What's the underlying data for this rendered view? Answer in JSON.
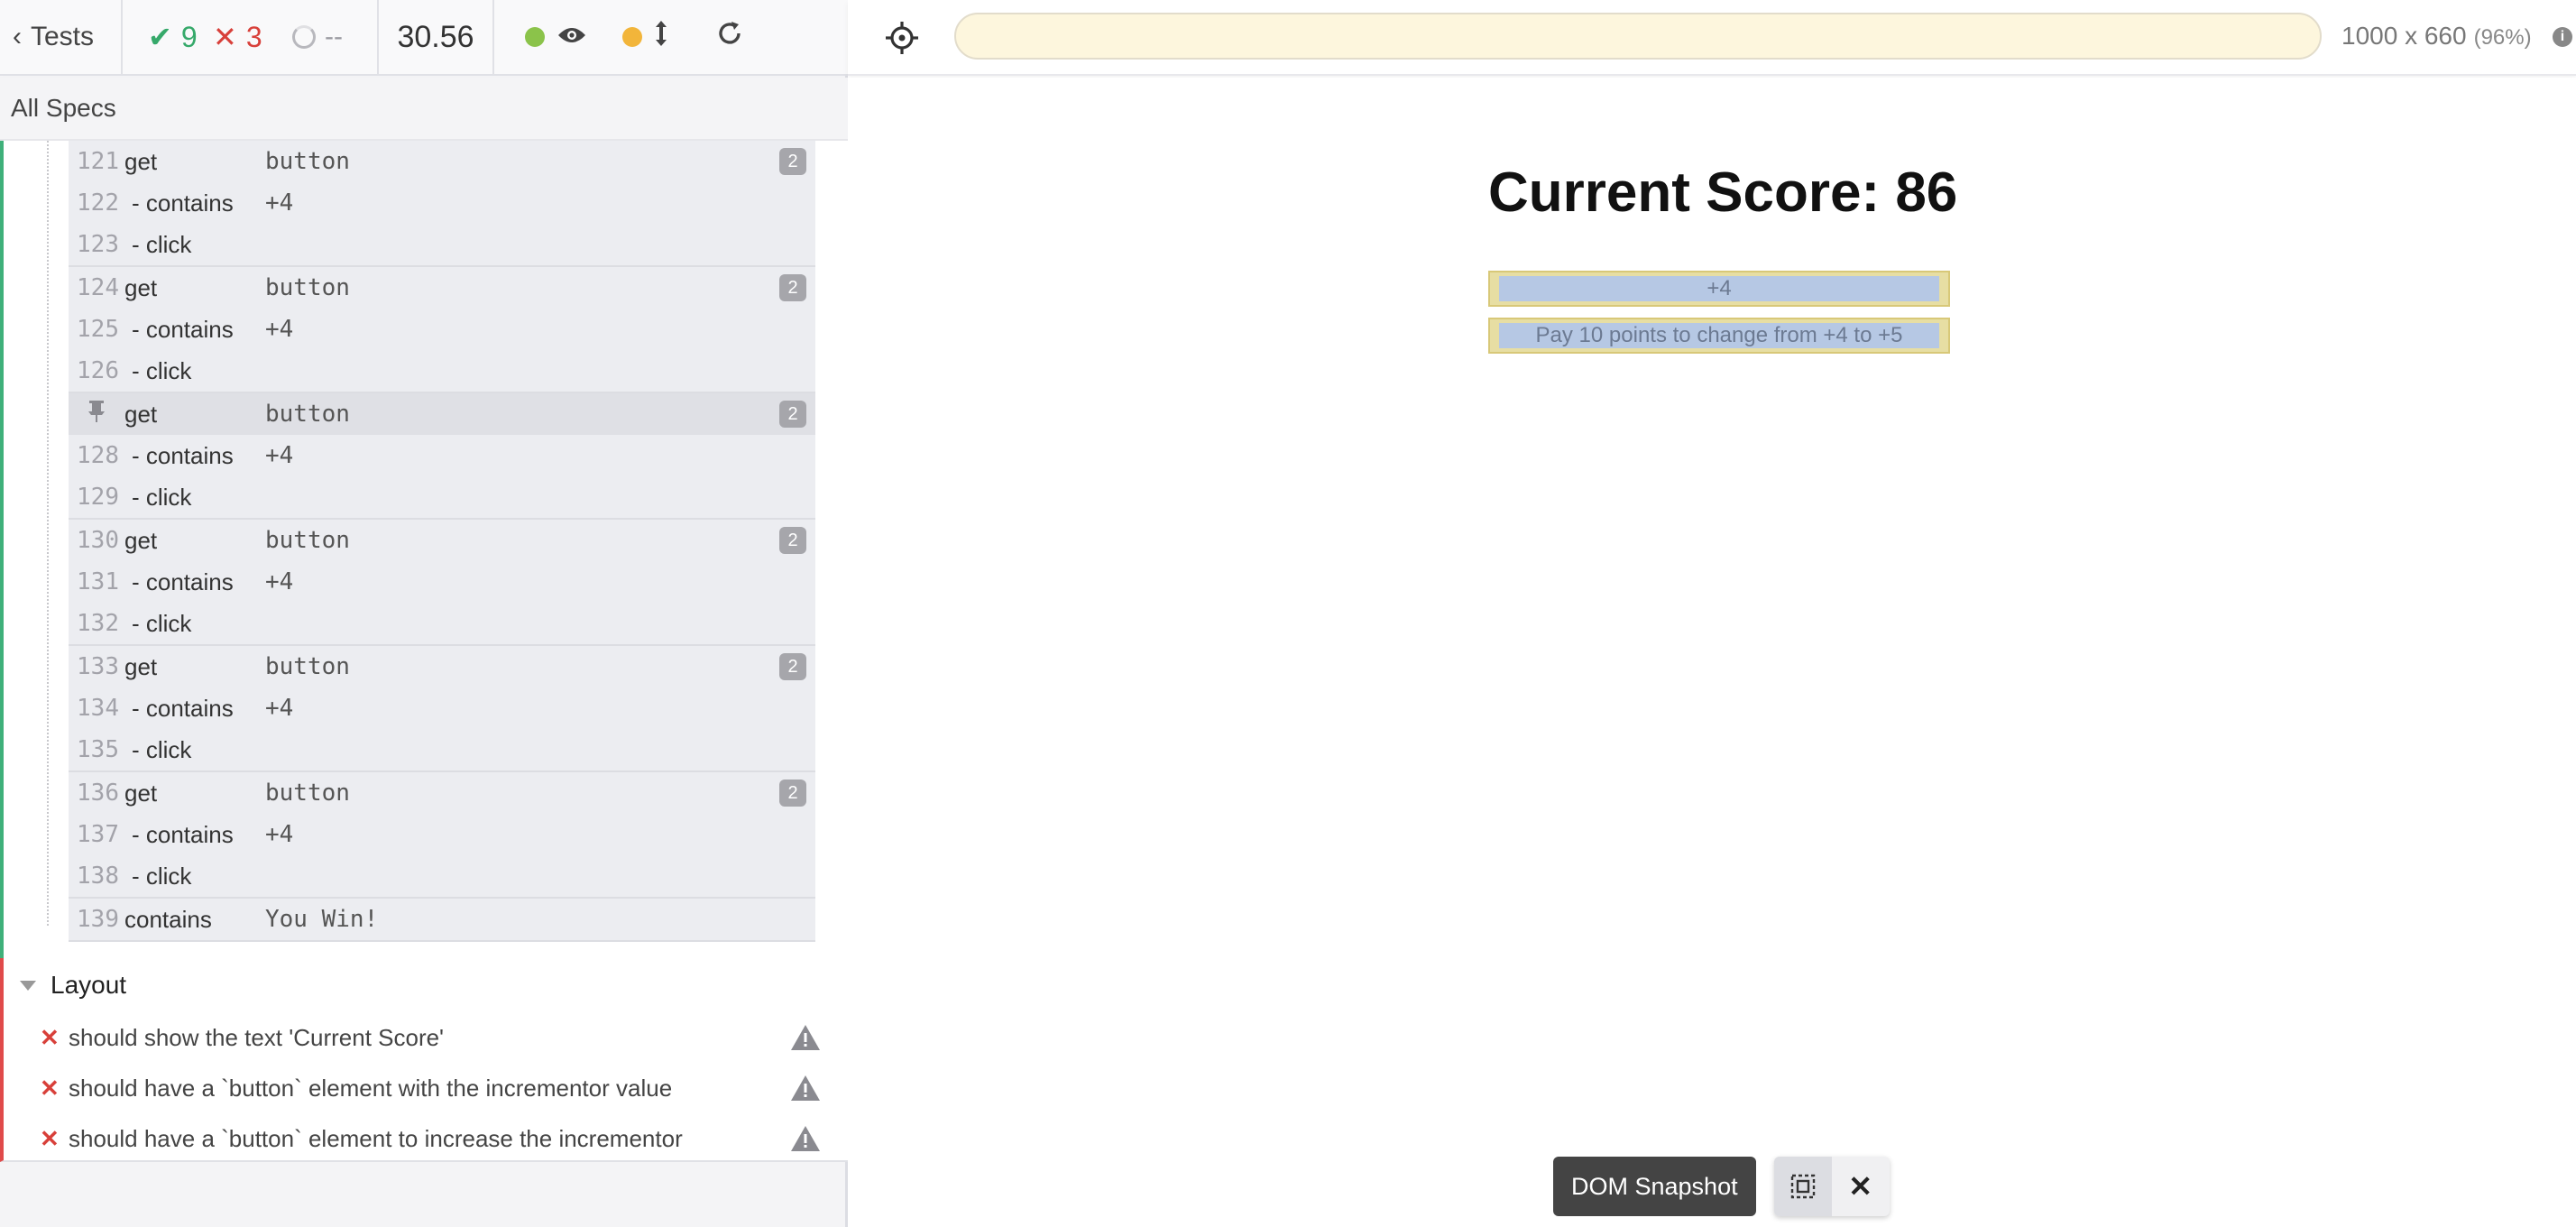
{
  "reporter": {
    "tests_label": "Tests",
    "passed_count": "9",
    "failed_count": "3",
    "pending_count": "--",
    "duration": "30.56",
    "specs_label": "All Specs",
    "colors": {
      "passed": "#36a96a",
      "failed": "#d8403a",
      "running_dot": "#8bc34a",
      "dot_yellow": "#f2b53a"
    }
  },
  "commands": [
    {
      "rows": [
        {
          "num": "121",
          "cmd": "get",
          "arg": "button",
          "badge": "2"
        },
        {
          "num": "122",
          "cmd": "- contains",
          "arg": "+4"
        },
        {
          "num": "123",
          "cmd": "- click",
          "arg": ""
        }
      ]
    },
    {
      "rows": [
        {
          "num": "124",
          "cmd": "get",
          "arg": "button",
          "badge": "2"
        },
        {
          "num": "125",
          "cmd": "- contains",
          "arg": "+4"
        },
        {
          "num": "126",
          "cmd": "- click",
          "arg": ""
        }
      ]
    },
    {
      "pinned": true,
      "rows": [
        {
          "num": "",
          "cmd": "get",
          "arg": "button",
          "badge": "2"
        },
        {
          "num": "128",
          "cmd": "- contains",
          "arg": "+4"
        },
        {
          "num": "129",
          "cmd": "- click",
          "arg": ""
        }
      ]
    },
    {
      "rows": [
        {
          "num": "130",
          "cmd": "get",
          "arg": "button",
          "badge": "2"
        },
        {
          "num": "131",
          "cmd": "- contains",
          "arg": "+4"
        },
        {
          "num": "132",
          "cmd": "- click",
          "arg": ""
        }
      ]
    },
    {
      "rows": [
        {
          "num": "133",
          "cmd": "get",
          "arg": "button",
          "badge": "2"
        },
        {
          "num": "134",
          "cmd": "- contains",
          "arg": "+4"
        },
        {
          "num": "135",
          "cmd": "- click",
          "arg": ""
        }
      ]
    },
    {
      "rows": [
        {
          "num": "136",
          "cmd": "get",
          "arg": "button",
          "badge": "2"
        },
        {
          "num": "137",
          "cmd": "- contains",
          "arg": "+4"
        },
        {
          "num": "138",
          "cmd": "- click",
          "arg": ""
        }
      ]
    },
    {
      "rows": [
        {
          "num": "139",
          "cmd": "contains",
          "arg": "You Win!"
        }
      ]
    }
  ],
  "layout_suite": {
    "title": "Layout",
    "tests": [
      "should show the text 'Current Score'",
      "should have a `button` element with the incrementor value",
      "should have a `button` element to increase the incrementor"
    ]
  },
  "aut": {
    "url": "",
    "viewport_size": "1000 x 660",
    "viewport_scale": "(96%)",
    "score_title": "Current Score: 86",
    "increment_button": "+4",
    "pay_button": "Pay 10 points to change from +4 to +5"
  },
  "snapshot": {
    "label": "DOM Snapshot"
  }
}
